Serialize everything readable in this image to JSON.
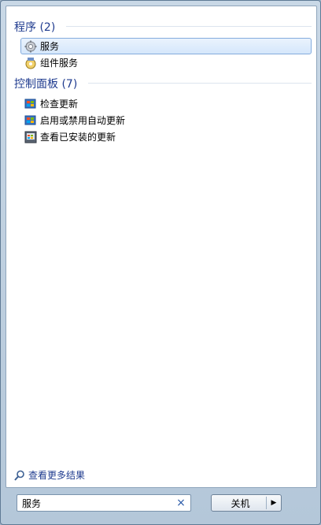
{
  "programs": {
    "title": "程序 (2)",
    "items": [
      {
        "label": "服务",
        "icon": "services-gear-icon",
        "selected": true
      },
      {
        "label": "组件服务",
        "icon": "component-services-icon",
        "selected": false
      }
    ]
  },
  "control_panel": {
    "title": "控制面板 (7)",
    "items": [
      {
        "label": "检查更新",
        "icon": "windows-update-icon"
      },
      {
        "label": "启用或禁用自动更新",
        "icon": "windows-update-icon"
      },
      {
        "label": "查看已安装的更新",
        "icon": "installed-updates-icon"
      }
    ]
  },
  "see_more": {
    "label": "查看更多结果",
    "icon": "magnifier-icon"
  },
  "search": {
    "value": "服务",
    "clear": "×"
  },
  "shutdown": {
    "label": "关机",
    "arrow": "▶"
  },
  "colors": {
    "accent": "#1f3b8f",
    "selection_border": "#84acdd"
  }
}
